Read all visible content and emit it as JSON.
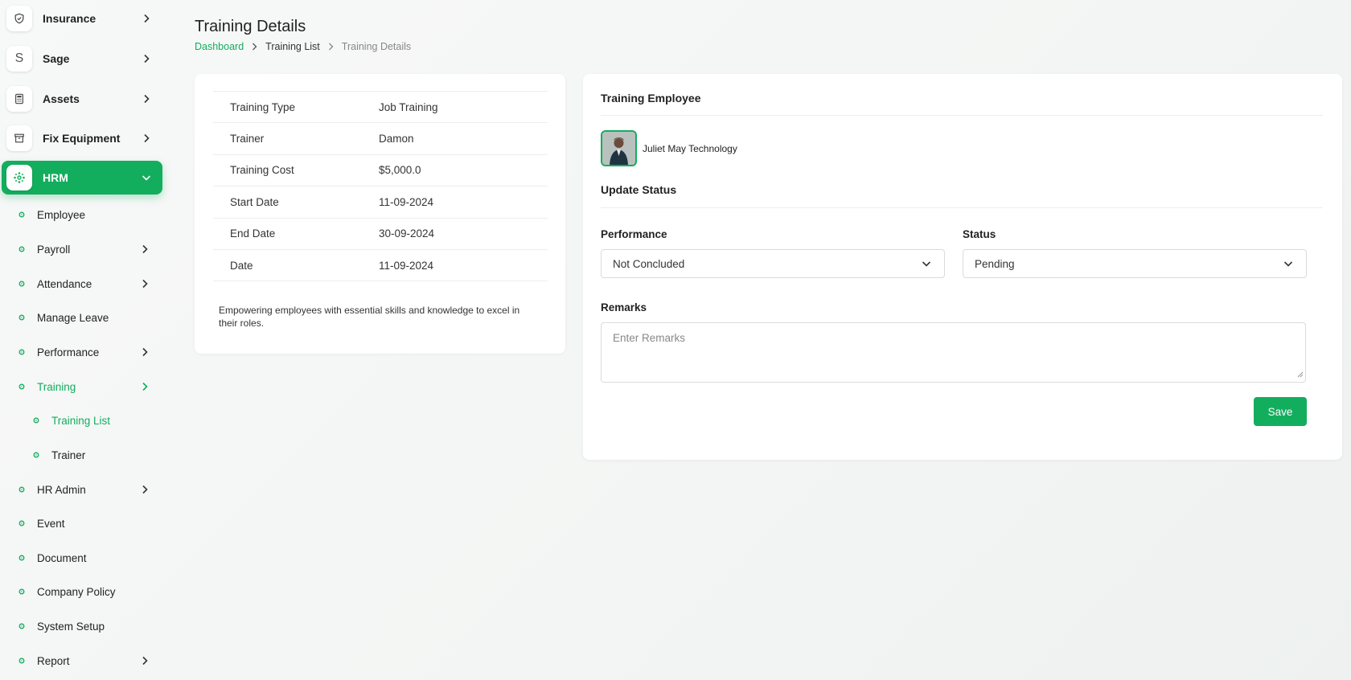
{
  "colors": {
    "accent": "#13ad5e",
    "text": "#222222",
    "border": "#d8dcdb"
  },
  "sidebar": {
    "top_items": [
      {
        "label": "Insurance",
        "icon": "shield-icon"
      },
      {
        "label": "Sage",
        "icon": "letter-s-icon",
        "icon_text": "S"
      },
      {
        "label": "Assets",
        "icon": "calculator-icon"
      },
      {
        "label": "Fix Equipment",
        "icon": "archive-box-icon"
      },
      {
        "label": "HRM",
        "icon": "hrm-hub-icon"
      }
    ],
    "sub_items": [
      {
        "label": "Employee"
      },
      {
        "label": "Payroll"
      },
      {
        "label": "Attendance"
      },
      {
        "label": "Manage Leave"
      },
      {
        "label": "Performance"
      },
      {
        "label": "Training"
      },
      {
        "label": "Training List"
      },
      {
        "label": "Trainer"
      },
      {
        "label": "HR Admin"
      },
      {
        "label": "Event"
      },
      {
        "label": "Document"
      },
      {
        "label": "Company Policy"
      },
      {
        "label": "System Setup"
      },
      {
        "label": "Report"
      }
    ]
  },
  "header": {
    "title": "Training Details",
    "breadcrumb": [
      "Dashboard",
      "Training List",
      "Training Details"
    ]
  },
  "details": {
    "rows": [
      {
        "label": "Training Type",
        "value": "Job Training"
      },
      {
        "label": "Trainer",
        "value": "Damon"
      },
      {
        "label": "Training Cost",
        "value": "$5,000.0"
      },
      {
        "label": "Start Date",
        "value": "11-09-2024"
      },
      {
        "label": "End Date",
        "value": "30-09-2024"
      },
      {
        "label": "Date",
        "value": "11-09-2024"
      }
    ],
    "description": "Empowering employees with essential skills and knowledge to excel in their roles."
  },
  "training_employee": {
    "title": "Training Employee",
    "employee_name": "Juliet May Technology"
  },
  "update_status": {
    "title": "Update Status",
    "performance_label": "Performance",
    "performance_value": "Not Concluded",
    "status_label": "Status",
    "status_value": "Pending",
    "remarks_label": "Remarks",
    "remarks_placeholder": "Enter Remarks",
    "save_label": "Save"
  }
}
